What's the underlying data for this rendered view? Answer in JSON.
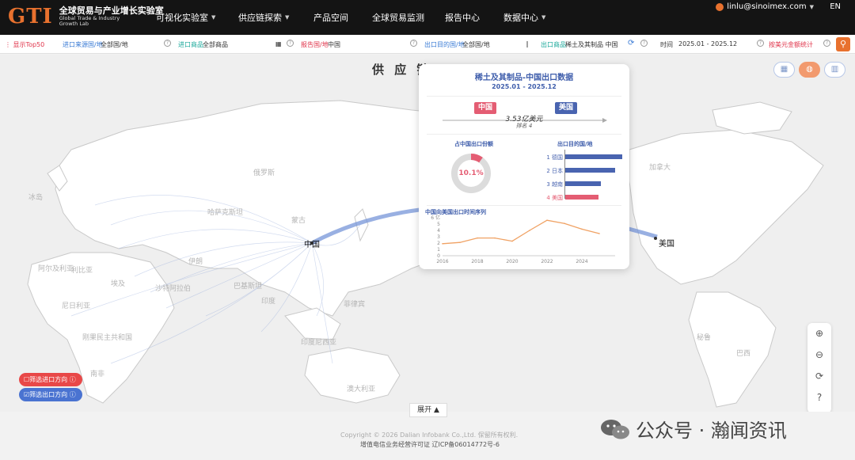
{
  "header": {
    "logo_mark": "GTI",
    "logo_cn": "全球贸易与产业增长实验室",
    "logo_en_1": "Global Trade & Industry",
    "logo_en_2": "Growth Lab",
    "nav": [
      "可视化实验室",
      "供应链探索",
      "产品空间",
      "全球贸易监测",
      "报告中心",
      "数据中心"
    ],
    "user_email": "linlu@sinoimex.com",
    "lang": "EN"
  },
  "filters": {
    "top50": "显示Top50",
    "import_src_label": "进口来源国/地",
    "import_src_value": "全部国/地",
    "import_goods_label": "进口商品",
    "import_goods_value": "全部商品",
    "report_label": "报告国/地",
    "report_value": "中国",
    "export_dest_label": "出口目的国/地",
    "export_dest_value": "全部国/地",
    "export_goods_label": "出口商品",
    "export_goods_value": "稀土及其制品 中国",
    "time_label": "时间",
    "time_value": "2025.01 - 2025.12",
    "stat_mode": "按美元金额统计"
  },
  "map": {
    "title": "供 应 链",
    "labels_main": [
      "中国",
      "美国"
    ],
    "labels_faint": [
      "俄罗斯",
      "哈萨克斯坦",
      "蒙古",
      "伊朗",
      "沙特阿拉伯",
      "埃及",
      "利比亚",
      "阿尔及利亚",
      "尼日利亚",
      "刚果民主共和国",
      "南非",
      "澳大利亚",
      "印度尼西亚",
      "菲律宾",
      "巴西",
      "秘鲁",
      "加拿大",
      "冰岛",
      "巴基斯坦",
      "印度"
    ],
    "chip_import": "筛选进口方向",
    "chip_export": "筛选出口方向",
    "expand": "展开"
  },
  "card": {
    "title": "稀土及其制品-中国出口数据",
    "period": "2025.01 - 2025.12",
    "exporter": "中国",
    "importer": "美国",
    "trade_value": "3.53亿美元",
    "rank": "排名 4",
    "share_label": "占中国出口份额",
    "share_value": "10.1%",
    "dest_label": "出口目的国/地",
    "dest": [
      "1 德国",
      "2 日本",
      "3 越南",
      "4 美国"
    ],
    "ts_title": "中国向美国出口时间序列",
    "accent_cn": "#e45d73",
    "accent_us": "#4964b0"
  },
  "chart_data": {
    "type": "line",
    "title": "中国向美国出口时间序列",
    "x": [
      2016,
      2017,
      2018,
      2019,
      2020,
      2021,
      2022,
      2023,
      2024,
      2025
    ],
    "values": [
      1.9,
      2.1,
      2.8,
      2.8,
      2.3,
      4.0,
      5.6,
      5.1,
      4.2,
      3.5
    ],
    "xticks": [
      "2016",
      "2018",
      "2020",
      "2022",
      "2024"
    ],
    "yticks": [
      "0",
      "1",
      "2",
      "3",
      "4",
      "5",
      "6 亿"
    ],
    "ylim": [
      0,
      6
    ]
  },
  "share_chart": {
    "share": 0.101
  },
  "dest_bars": {
    "values": [
      1.0,
      0.88,
      0.62,
      0.58
    ]
  },
  "footer": {
    "copyright": "Copyright © 2026 Dalian Infobank Co.,Ltd. 保留所有权利.",
    "icp": "增值电信业务经营许可证     辽ICP备06014772号-6",
    "watermark": "公众号 · 瀚闻资讯"
  },
  "icons": [
    "search-icon",
    "refresh-icon",
    "zoom-in-icon",
    "zoom-out-icon",
    "reset-icon",
    "help-icon",
    "table-view-icon",
    "map-view-icon",
    "chart-view-icon",
    "user-icon"
  ]
}
